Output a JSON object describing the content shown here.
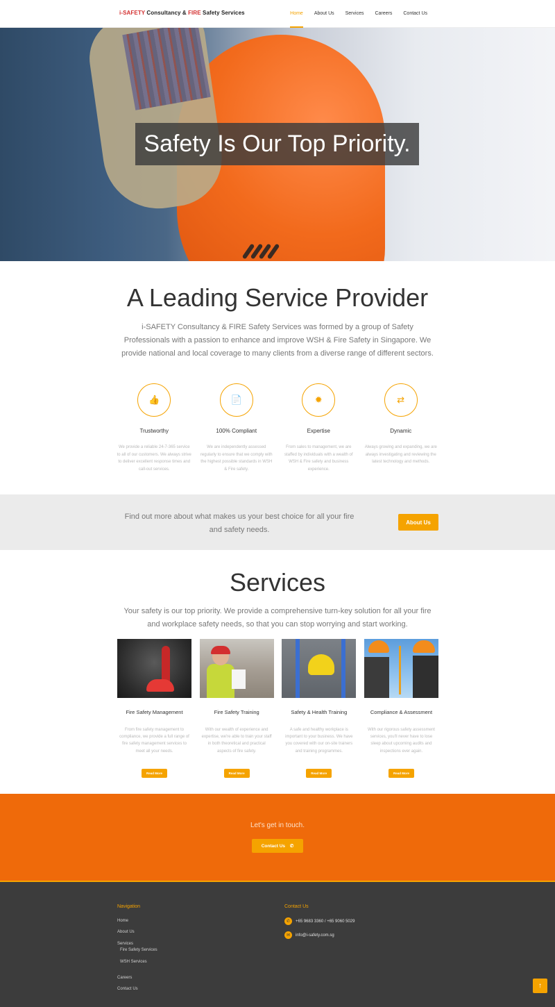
{
  "header": {
    "logo_prefix": "i-SAFETY",
    "logo_middle": " Consultancy & ",
    "logo_fire": "FIRE",
    "logo_suffix": " Safety Services",
    "nav": [
      "Home",
      "About Us",
      "Services",
      "Careers",
      "Contact Us"
    ],
    "active_nav": "Home"
  },
  "hero": {
    "caption": "Safety Is Our Top Priority."
  },
  "intro": {
    "title": "A Leading Service Provider",
    "text": "i-SAFETY Consultancy & FIRE Safety Services was formed  by a group of Safety Professionals with a passion to enhance and improve WSH & Fire Safety in Singapore. We provide national and local coverage to many clients from a diverse range of different sectors."
  },
  "features": [
    {
      "icon": "thumbs-up-icon",
      "glyph": "👍",
      "title": "Trustworthy",
      "text": "We provide a reliable 24-7-365 service to all of our customers. We always strive to deliver excellent response times and call-out services."
    },
    {
      "icon": "document-icon",
      "glyph": "📄",
      "title": "100% Compliant",
      "text": "We are independently assessed regularly to ensure that we comply with the highest possible standards in WSH & Fire safety."
    },
    {
      "icon": "sun-icon",
      "glyph": "✹",
      "title": "Expertise",
      "text": "From sales to management, we are staffed by individuals with a wealth of WSH & Fire safety and business experience."
    },
    {
      "icon": "shuffle-icon",
      "glyph": "⇄",
      "title": "Dynamic",
      "text": "Always growing and expanding, we are always investigating and reviewing the latest technology and methods."
    }
  ],
  "band": {
    "text": "Find out more about what makes us your best choice for all your fire and safety needs.",
    "button": "About Us"
  },
  "services": {
    "title": "Services",
    "text": "Your safety is our top priority. We provide a comprehensive turn-key solution for all your fire and workplace safety needs, so that you can stop worrying and start working.",
    "items": [
      {
        "title": "Fire Safety Management",
        "text": "From fire safety management to compliance, we provide a full range of fire safety management services to meet all your needs.",
        "button": "Read More"
      },
      {
        "title": "Fire Safety Training",
        "text": "With our wealth of experience and expertise, we're able to train your staff in both theoretical and practical aspects of fire safety.",
        "button": "Read More"
      },
      {
        "title": "Safety & Health Training",
        "text": "A safe and healthy workplace is important to your business. We have you covered with our on-site trainers and training programmes.",
        "button": "Read More"
      },
      {
        "title": "Compliance & Assessment",
        "text": "With our rigorous safety assessment services, you'll never have to lose sleep about upcoming audits and inspections ever again.",
        "button": "Read More"
      }
    ]
  },
  "contact_band": {
    "text": "Let's get in touch.",
    "button": "Contact Us",
    "button_icon": "phone-icon"
  },
  "footer": {
    "nav_title": "Navigation",
    "nav_home": "Home",
    "nav_about": "About Us",
    "nav_services": "Services",
    "nav_fire": "Fire Safety Services",
    "nav_wsh": "WSH Services",
    "nav_careers": "Careers",
    "nav_contact": "Contact Us",
    "contact_title": "Contact Us",
    "phone": "+65 9683 3360 / +65 9060 5029",
    "email": "info@i-safety.com.sg"
  },
  "colors": {
    "accent": "#f5a300",
    "orange_band": "#ef6a0a",
    "footer_bg": "#3c3c3c"
  }
}
